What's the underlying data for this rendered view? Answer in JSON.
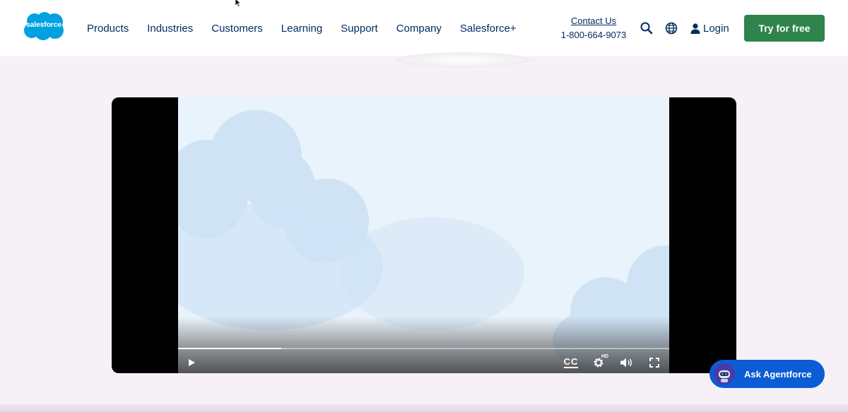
{
  "brand": {
    "logo_text": "salesforce",
    "color": "#00a1e0"
  },
  "nav": {
    "items": [
      {
        "label": "Products"
      },
      {
        "label": "Industries"
      },
      {
        "label": "Customers"
      },
      {
        "label": "Learning"
      },
      {
        "label": "Support"
      },
      {
        "label": "Company"
      },
      {
        "label": "Salesforce+"
      }
    ]
  },
  "contact": {
    "link_label": "Contact Us",
    "phone": "1-800-664-9073"
  },
  "header_actions": {
    "search_icon": "search-icon",
    "globe_icon": "globe-icon",
    "login_label": "Login",
    "cta_label": "Try for free",
    "cta_color": "#2e844a"
  },
  "video": {
    "progress": 0.21,
    "controls": {
      "play": "play-icon",
      "cc_label": "CC",
      "hd_label": "HD",
      "settings": "gear-icon",
      "volume": "volume-icon",
      "fullscreen": "fullscreen-icon"
    }
  },
  "agent": {
    "label": "Ask Agentforce",
    "color": "#0b5cd5"
  }
}
